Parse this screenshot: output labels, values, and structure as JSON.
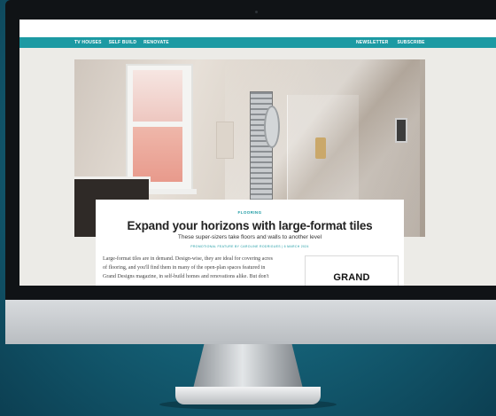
{
  "nav": {
    "left_items": [
      "TV HOUSES",
      "SELF BUILD",
      "RENOVATE"
    ],
    "right_items": [
      "NEWSLETTER",
      "SUBSCRIBE"
    ]
  },
  "article": {
    "kicker": "FLOORING",
    "title": "Expand your horizons with large-format tiles",
    "subtitle": "These super-sizers take floors and walls to another level",
    "byline": "PROMOTIONAL FEATURE BY CAROLINE RODRIGUES | 6 MARCH 2024",
    "body_lines": [
      "Large-format tiles are in demand. Design-wise, they are ideal for covering acres",
      "of flooring, and you'll find them in many of the open-plan spaces featured in",
      "Grand Designs magazine, in self-build homes and renovations alike. But don't"
    ]
  },
  "ad": {
    "text": "GRAND"
  },
  "colors": {
    "accent": "#1c9aa3",
    "background": "#15647a"
  }
}
